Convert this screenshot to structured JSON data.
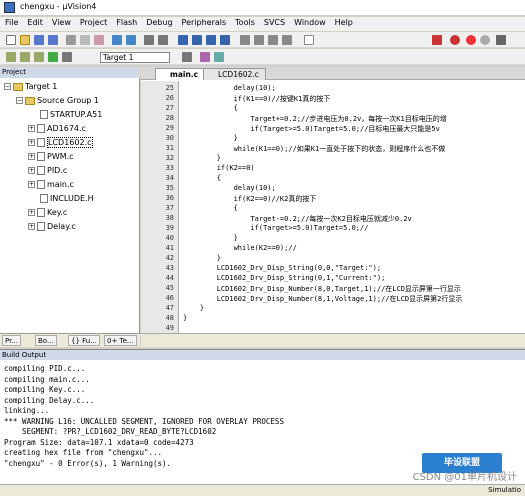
{
  "window": {
    "title": "chengxu - µVision4"
  },
  "menu": [
    "File",
    "Edit",
    "View",
    "Project",
    "Flash",
    "Debug",
    "Peripherals",
    "Tools",
    "SVCS",
    "Window",
    "Help"
  ],
  "toolbar2": {
    "target": "Target 1"
  },
  "project": {
    "header": "Project",
    "root": "Target 1",
    "group": "Source Group 1",
    "files": [
      "STARTUP.A51",
      "AD1674.c",
      "LCD1602.c",
      "PWM.c",
      "PID.c",
      "main.c",
      "INCLUDE.H",
      "Key.c",
      "Delay.c"
    ],
    "tabs": [
      "Pr...",
      "Bo...",
      "{} Fu...",
      "0+ Te..."
    ]
  },
  "editor": {
    "tabs": [
      "main.c",
      "LCD1602.c"
    ],
    "lines": [
      {
        "n": "25",
        "t": "            delay(10);"
      },
      {
        "n": "26",
        "t": "            if(K1==0)//按键K1真的按下"
      },
      {
        "n": "27",
        "t": "            {"
      },
      {
        "n": "28",
        "t": "                Target+=0.2;//步进电压为0.2v，每按一次K1目标电压的增"
      },
      {
        "n": "29",
        "t": "                if(Target>=5.0)Target=5.0;//目标电压最大只能是5v"
      },
      {
        "n": "30",
        "t": "            }"
      },
      {
        "n": "31",
        "t": "            while(K1==0);//如果K1一直处于按下的状态，则程序什么也不做"
      },
      {
        "n": "32",
        "t": "        }"
      },
      {
        "n": "33",
        "t": "        if(K2==0)"
      },
      {
        "n": "34",
        "t": "        {"
      },
      {
        "n": "35",
        "t": "            delay(10);"
      },
      {
        "n": "36",
        "t": "            if(K2==0)//K2真的按下"
      },
      {
        "n": "37",
        "t": "            {"
      },
      {
        "n": "38",
        "t": "                Target-=0.2;//每按一次K2目标电压就减少0.2v"
      },
      {
        "n": "39",
        "t": "                if(Target>=5.0)Target=5.0;//"
      },
      {
        "n": "40",
        "t": "            }"
      },
      {
        "n": "41",
        "t": "            while(K2==0);//"
      },
      {
        "n": "42",
        "t": "        }"
      },
      {
        "n": "43",
        "t": "        LCD1602_Drv_Disp_String(0,0,\"Target:\");"
      },
      {
        "n": "44",
        "t": "        LCD1602_Drv_Disp_String(0,1,\"Current:\");"
      },
      {
        "n": "45",
        "t": "        LCD1602_Drv_Disp_Number(8,0,Target,1);//在LCD显示屏第一行显示"
      },
      {
        "n": "46",
        "t": "        LCD1602_Drv_Disp_Number(8,1,Voltage,1);//在LCD显示屏第2行显示"
      },
      {
        "n": "47",
        "t": "    }"
      },
      {
        "n": "48",
        "t": "}"
      },
      {
        "n": "49",
        "t": ""
      }
    ]
  },
  "build": {
    "header": "Build Output",
    "lines": [
      "compiling PID.c...",
      "compiling main.c...",
      "compiling Key.c...",
      "compiling Delay.c...",
      "linking...",
      "*** WARNING L16: UNCALLED SEGMENT, IGNORED FOR OVERLAY PROCESS",
      "    SEGMENT: ?PR?_LCD1602_DRV_READ_BYTE?LCD1602",
      "Program Size: data=107.1 xdata=0 code=4273",
      "creating hex file from \"chengxu\"...",
      "\"chengxu\" - 0 Error(s), 1 Warning(s)."
    ]
  },
  "status": {
    "right": "Simulatio"
  },
  "watermark": "CSDN @01单片机设计",
  "logo": "毕设联盟"
}
